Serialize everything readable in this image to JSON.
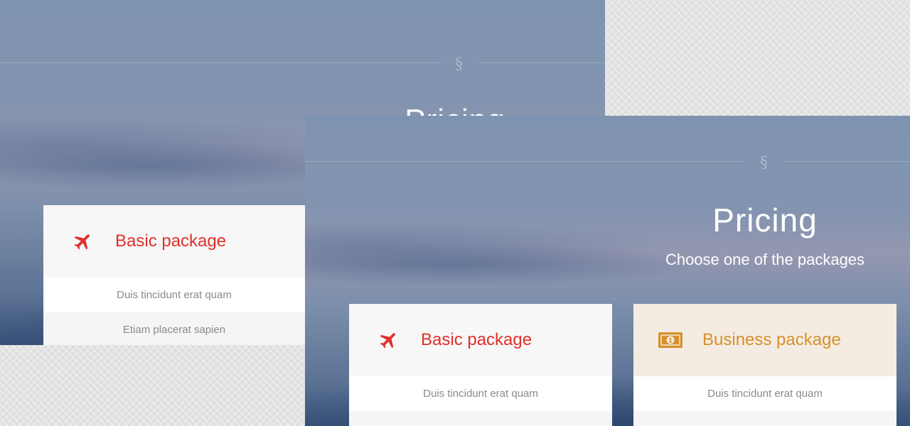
{
  "colors": {
    "accent_red": "#e0302b",
    "accent_orange": "#d7902a"
  },
  "back_section": {
    "mark": "§",
    "title": "Pricing",
    "basic_card": {
      "icon": "airplane-icon",
      "name": "Basic package",
      "features": [
        "Duis tincidunt erat quam",
        "Etiam placerat sapien"
      ]
    }
  },
  "front_section": {
    "mark": "§",
    "title": "Pricing",
    "subtitle": "Choose one of the packages",
    "basic_card": {
      "icon": "airplane-icon",
      "name": "Basic package",
      "features": [
        "Duis tincidunt erat quam",
        ""
      ]
    },
    "business_card": {
      "icon": "money-bill-icon",
      "name": "Business package",
      "features": [
        "Duis tincidunt erat quam",
        ""
      ]
    }
  }
}
